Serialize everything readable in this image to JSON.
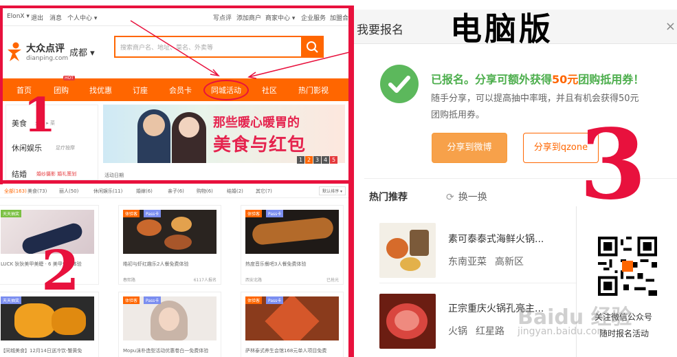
{
  "left": {
    "topbar": {
      "user": "ElonX ▾",
      "logout": "退出",
      "messages": "消息",
      "personal": "个人中心 ▾",
      "write_review": "写点评",
      "add_merchant": "添加商户",
      "merchant_center": "商家中心 ▾",
      "enterprise": "企业服务",
      "join": "加盟合"
    },
    "logo": {
      "cn": "大众点评",
      "en": "dianping.com"
    },
    "city": "成都 ▾",
    "search": {
      "placeholder": "搜索商户名、地址、菜名、外卖等"
    },
    "nav": {
      "items": [
        "首页",
        "团购",
        "找优惠",
        "订座",
        "会员卡",
        "同城活动",
        "社区",
        "热门影视"
      ],
      "hot_badge": "HOT"
    },
    "categories": [
      {
        "name": "美食",
        "sub": "火锅  ▸ 菜"
      },
      {
        "name": "休闲娱乐",
        "sub": "足疗按摩"
      },
      {
        "name": "结婚",
        "sub": "婚纱摄影  婚礼策划"
      }
    ],
    "banner": {
      "title": "那些暖心暖胃的",
      "headline": "美食与红包",
      "pages": [
        "1",
        "2",
        "3",
        "4",
        "5"
      ],
      "activity_label": "活动日期"
    },
    "filter": {
      "items": [
        "全部(163)",
        "美食(73)",
        "丽人(50)",
        "休闲娱乐(11)",
        "婚嫁(6)",
        "亲子(6)",
        "购物(6)",
        "结婚(2)",
        "其它(7)"
      ],
      "sort": "默认排序 ▾"
    },
    "cards": [
      {
        "tag": "天天抽奖",
        "tag2": "",
        "title": "LUCK 狄狄美甲美睫 · 6 美甲免费体验",
        "meta": "",
        "right": ""
      },
      {
        "tag": "体验客",
        "tag2": "Pass卡",
        "title": "皓初与虾红趣乐2人餐免费体验",
        "meta": "春熙路",
        "right": "6117人报名"
      },
      {
        "tag": "体验客",
        "tag2": "Pass卡",
        "title": "热度音乐餐吧3人餐免费体验",
        "meta": "西安北路",
        "right": "已抢光"
      },
      {
        "tag": "天天抽奖",
        "tag2": "",
        "title": "【同城美食】12月14日送冷饮-蟹黄免",
        "meta": "",
        "right": ""
      },
      {
        "tag": "体验客",
        "tag2": "Pass卡",
        "title": "Mopu沫朴造型活动优惠卷白一免费体验",
        "meta": "",
        "right": ""
      },
      {
        "tag": "体验客",
        "tag2": "Pass卡",
        "title": "萨林泰式养生会馆168元单人项目免费",
        "meta": "",
        "right": ""
      }
    ],
    "annotations": [
      "1",
      "2"
    ]
  },
  "right": {
    "dialog_title": "我要报名",
    "close": "×",
    "big_label": "电脑版",
    "success": {
      "prefix": "已报名。分享可额外获得",
      "highlight": "50元",
      "suffix": "团购抵用券！",
      "desc": "随手分享，可以提高抽中率哦，并且有机会获得50元团购抵用券。"
    },
    "share_weibo": "分享到微博",
    "share_qzone": "分享到qzone",
    "rec_title": "热门推荐",
    "rec_refresh": "换一换",
    "recommendations": [
      {
        "name": "素可泰泰式海鲜火锅...",
        "cat": "东南亚菜",
        "area": "高新区"
      },
      {
        "name": "正宗重庆火锅孔亮主...",
        "cat": "火锅",
        "area": "红星路"
      }
    ],
    "qr_text1": "关注微信公众号",
    "qr_text2": "随时报名活动",
    "watermark": "Baidu 经验",
    "watermark_url": "jingyan.baidu.com",
    "annotation": "3"
  },
  "colors": {
    "accent": "#ff6600",
    "marker": "#e8113d",
    "success": "#5cb85c"
  }
}
